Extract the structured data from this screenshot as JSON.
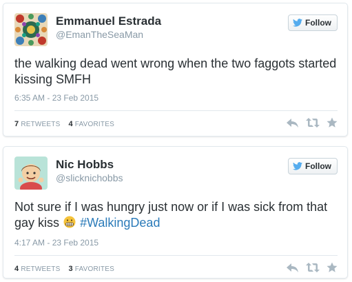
{
  "tweets": [
    {
      "display_name": "Emmanuel Estrada",
      "handle": "@EmanTheSeaMan",
      "follow_label": "Follow",
      "text": "the walking dead went wrong when the two faggots started kissing SMFH",
      "timestamp": "6:35 AM - 23 Feb 2015",
      "retweets_count": "7",
      "retweets_label": "RETWEETS",
      "favorites_count": "4",
      "favorites_label": "FAVORITES",
      "avatar_icon": "colorful-pattern-avatar"
    },
    {
      "display_name": "Nic Hobbs",
      "handle": "@slicknichobbs",
      "follow_label": "Follow",
      "text": "Not sure if I was hungry just now or if I was sick from that gay kiss",
      "emoji_icon": "grimacing-face-icon",
      "hashtag": "#WalkingDead",
      "timestamp": "4:17 AM - 23 Feb 2015",
      "retweets_count": "4",
      "retweets_label": "RETWEETS",
      "favorites_count": "3",
      "favorites_label": "FAVORITES",
      "avatar_icon": "cartoon-boy-avatar"
    }
  ],
  "colors": {
    "text": "#292f33",
    "muted": "#8899a6",
    "border": "#e1e8ed",
    "twitter_blue": "#55acee",
    "hashtag": "#2b7bb9",
    "action_icon": "#aab8c2"
  }
}
